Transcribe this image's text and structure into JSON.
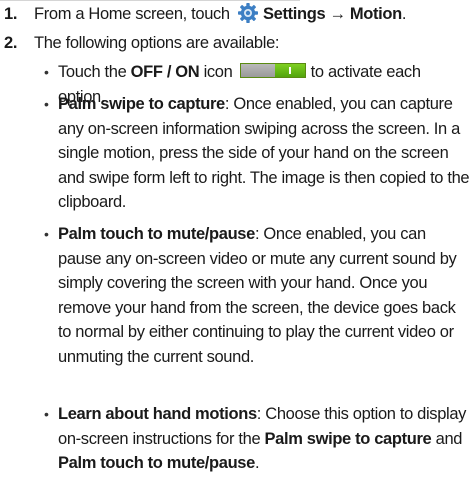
{
  "steps": [
    {
      "number": "1.",
      "text_before": "From a Home screen, touch",
      "icon": "settings-gear-icon",
      "bold_text": "Settings → Motion",
      "text_after": "."
    },
    {
      "number": "2.",
      "text": "The following options are available:"
    }
  ],
  "bullets": [
    {
      "parts": [
        {
          "text": "Touch the ",
          "bold": false
        },
        {
          "text": "OFF / ON",
          "bold": true
        },
        {
          "text": " icon",
          "bold": false
        }
      ],
      "icon": "on-off-toggle-icon",
      "after_icon": " to activate each option."
    },
    {
      "parts": [
        {
          "text": "Palm swipe to capture",
          "bold": true
        },
        {
          "text": ": Once enabled, you can capture any on-screen information swiping across the screen. In a single motion, press the side of your hand on the screen and swipe form left to right. The image is then copied to the clipboard.",
          "bold": false
        }
      ]
    },
    {
      "parts": [
        {
          "text": "Palm touch to mute/pause",
          "bold": true
        },
        {
          "text": ": Once enabled, you can pause any on-screen video or mute any current sound by simply covering the screen with your hand. Once you remove your hand from the screen, the device goes back to normal by either continuing to play the current video or unmuting the current sound.",
          "bold": false
        }
      ]
    },
    {
      "parts": [
        {
          "text": "Learn about hand motions",
          "bold": true
        },
        {
          "text": ": Choose this option to display on-screen instructions for the ",
          "bold": false
        },
        {
          "text": "Palm swipe to capture",
          "bold": true
        },
        {
          "text": " and ",
          "bold": false
        },
        {
          "text": "Palm touch to mute/pause",
          "bold": true
        },
        {
          "text": ".",
          "bold": false
        }
      ]
    }
  ],
  "colors": {
    "toggle_on": "#6ea41a",
    "gear_blue": "#3d7fc4"
  }
}
